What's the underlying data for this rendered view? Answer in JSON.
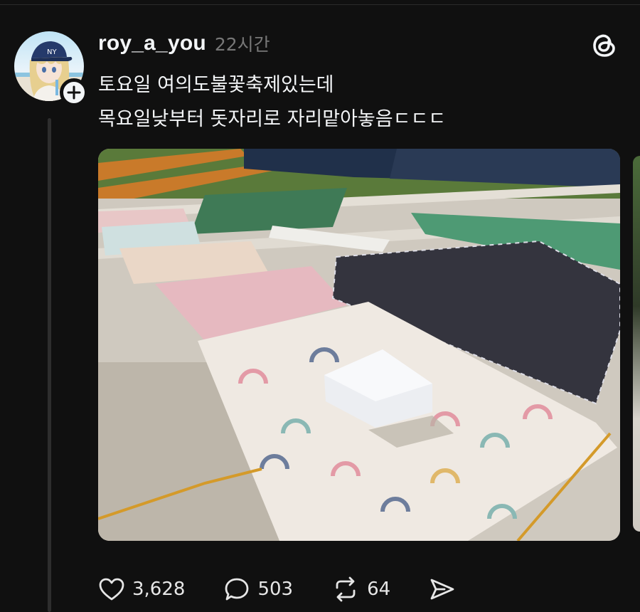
{
  "post": {
    "username": "roy_a_you",
    "timestamp": "22시간",
    "lines": [
      "토요일 여의도불꽃축제있는데",
      "목요일낮부터 돗자리로 자리맡아놓음ㄷㄷㄷ"
    ],
    "media": {
      "icon": "photo-of-picnic-mats-on-stairs"
    }
  },
  "actions": {
    "like_count": "3,628",
    "reply_count": "503",
    "repost_count": "64"
  },
  "colors": {
    "background": "#101010",
    "text": "#f3f5f7",
    "muted": "#777777"
  }
}
